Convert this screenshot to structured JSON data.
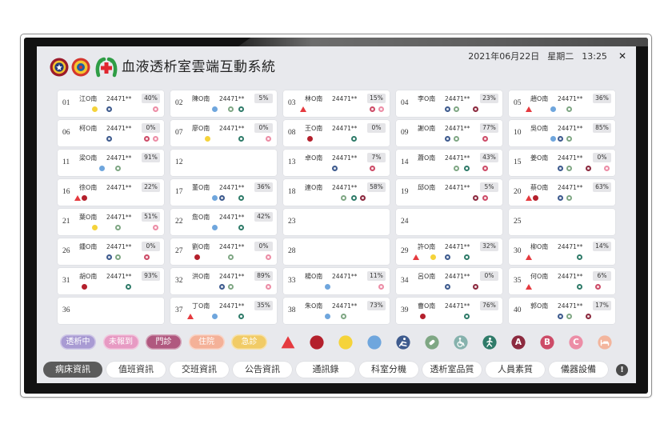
{
  "app": {
    "title": "血液透析室雲端互動系統",
    "date": "2021年06月22日",
    "weekday": "星期二",
    "time": "13:25",
    "close_icon": "close-icon",
    "close_glyph": "✕"
  },
  "logos": [
    "hospital-emblem-logo",
    "association-emblem-logo",
    "green-cross-logo"
  ],
  "colors": {
    "screen_bg": "#e8e9ed",
    "card_bg": "#ffffff",
    "percent_bg": "#e5e5e8",
    "active_tab_bg": "#5b5b5b",
    "tab_bg": "#ffffff"
  },
  "beds": [
    {
      "no": "01",
      "name": "江O南",
      "id": "24471**",
      "progress": "40%",
      "icons": [
        "yellow-dot",
        "wheelchair-navy",
        "grade-c"
      ]
    },
    {
      "no": "02",
      "name": "陳O南",
      "id": "24471**",
      "progress": "5%",
      "icons": [
        "blue-dot",
        "pill-green",
        "person-green"
      ]
    },
    {
      "no": "03",
      "name": "林O南",
      "id": "24471**",
      "progress": "15%",
      "icons": [
        "alert",
        "grade-b",
        "grade-c"
      ]
    },
    {
      "no": "04",
      "name": "李O南",
      "id": "24471**",
      "progress": "23%",
      "icons": [
        "wheelchair-navy",
        "pill-green",
        "grade-a"
      ]
    },
    {
      "no": "05",
      "name": "趙O南",
      "id": "24471**",
      "progress": "36%",
      "icons": [
        "alert",
        "blue-dot",
        "pill-green"
      ]
    },
    {
      "no": "06",
      "name": "柯O南",
      "id": "24471**",
      "progress": "0%",
      "icons": [
        "wheelchair-navy",
        "grade-b",
        "grade-c"
      ]
    },
    {
      "no": "07",
      "name": "廖O南",
      "id": "24471**",
      "progress": "0%",
      "icons": [
        "yellow-dot",
        "person-green",
        "grade-c"
      ]
    },
    {
      "no": "08",
      "name": "王O南",
      "id": "24471**",
      "progress": "0%",
      "icons": [
        "red-dot",
        "person-green"
      ]
    },
    {
      "no": "09",
      "name": "謝O南",
      "id": "24471**",
      "progress": "77%",
      "icons": [
        "wheelchair-navy",
        "pill-green",
        "grade-b"
      ]
    },
    {
      "no": "10",
      "name": "吳O南",
      "id": "24471**",
      "progress": "85%",
      "icons": [
        "blue-dot",
        "wheelchair-navy",
        "pill-green"
      ]
    },
    {
      "no": "11",
      "name": "梁O南",
      "id": "24471**",
      "progress": "91%",
      "icons": [
        "blue-dot",
        "pill-green"
      ]
    },
    {
      "no": "12"
    },
    {
      "no": "13",
      "name": "卓O南",
      "id": "24471**",
      "progress": "7%",
      "icons": [
        "wheelchair-navy",
        "grade-b"
      ]
    },
    {
      "no": "14",
      "name": "蕭O南",
      "id": "24471**",
      "progress": "43%",
      "icons": [
        "pill-green",
        "person-green",
        "grade-b"
      ]
    },
    {
      "no": "15",
      "name": "姜O南",
      "id": "24471**",
      "progress": "0%",
      "icons": [
        "wheelchair-navy",
        "pill-green",
        "grade-a",
        "grade-c"
      ]
    },
    {
      "no": "16",
      "name": "徐O南",
      "id": "24471**",
      "progress": "22%",
      "icons": [
        "alert",
        "red-dot"
      ]
    },
    {
      "no": "17",
      "name": "董O南",
      "id": "24471**",
      "progress": "36%",
      "icons": [
        "blue-dot",
        "wheelchair-navy",
        "person-green"
      ]
    },
    {
      "no": "18",
      "name": "連O南",
      "id": "24471**",
      "progress": "58%",
      "icons": [
        "pill-green",
        "person-green",
        "grade-a"
      ]
    },
    {
      "no": "19",
      "name": "邱O南",
      "id": "24471**",
      "progress": "5%",
      "icons": [
        "grade-a",
        "grade-b"
      ]
    },
    {
      "no": "20",
      "name": "蔡O南",
      "id": "24471**",
      "progress": "63%",
      "icons": [
        "alert",
        "red-dot",
        "wheelchair-navy",
        "pill-green"
      ]
    },
    {
      "no": "21",
      "name": "葉O南",
      "id": "24471**",
      "progress": "51%",
      "icons": [
        "yellow-dot",
        "pill-green",
        "grade-c"
      ]
    },
    {
      "no": "22",
      "name": "詹O南",
      "id": "24471**",
      "progress": "42%",
      "icons": [
        "blue-dot",
        "person-green"
      ]
    },
    {
      "no": "23"
    },
    {
      "no": "24"
    },
    {
      "no": "25"
    },
    {
      "no": "26",
      "name": "鍾O南",
      "id": "24471**",
      "progress": "0%",
      "icons": [
        "wheelchair-navy",
        "pill-green",
        "grade-b"
      ]
    },
    {
      "no": "27",
      "name": "劉O南",
      "id": "24471**",
      "progress": "0%",
      "icons": [
        "red-dot",
        "pill-green",
        "grade-c"
      ]
    },
    {
      "no": "28"
    },
    {
      "no": "29",
      "name": "許O南",
      "id": "24471**",
      "progress": "32%",
      "icons": [
        "alert",
        "yellow-dot",
        "wheelchair-navy",
        "person-green"
      ]
    },
    {
      "no": "30",
      "name": "柳O南",
      "id": "24471**",
      "progress": "14%",
      "icons": [
        "alert",
        "person-green"
      ]
    },
    {
      "no": "31",
      "name": "胡O南",
      "id": "24471**",
      "progress": "93%",
      "icons": [
        "red-dot",
        "person-green"
      ]
    },
    {
      "no": "32",
      "name": "洪O南",
      "id": "24471**",
      "progress": "89%",
      "icons": [
        "wheelchair-navy",
        "pill-green",
        "grade-c"
      ]
    },
    {
      "no": "33",
      "name": "楊O南",
      "id": "24471**",
      "progress": "11%",
      "icons": [
        "blue-dot",
        "grade-c"
      ]
    },
    {
      "no": "34",
      "name": "呂O南",
      "id": "24471**",
      "progress": "0%",
      "icons": [
        "wheelchair-navy",
        "grade-a"
      ]
    },
    {
      "no": "35",
      "name": "何O南",
      "id": "24471**",
      "progress": "6%",
      "icons": [
        "alert",
        "person-green",
        "grade-b"
      ]
    },
    {
      "no": "36"
    },
    {
      "no": "37",
      "name": "丁O南",
      "id": "24471**",
      "progress": "35%",
      "icons": [
        "alert",
        "blue-dot",
        "person-green"
      ]
    },
    {
      "no": "38",
      "name": "朱O南",
      "id": "24471**",
      "progress": "73%",
      "icons": [
        "blue-dot",
        "pill-green"
      ]
    },
    {
      "no": "39",
      "name": "曹O南",
      "id": "24471**",
      "progress": "76%",
      "icons": [
        "red-dot",
        "person-green"
      ]
    },
    {
      "no": "40",
      "name": "郭O南",
      "id": "24471**",
      "progress": "17%",
      "icons": [
        "wheelchair-navy",
        "pill-green",
        "grade-a"
      ]
    }
  ],
  "legend": {
    "statuses": [
      {
        "label": "透析中",
        "color": "#a99bd3"
      },
      {
        "label": "未報到",
        "color": "#e79ac3"
      },
      {
        "label": "門診",
        "color": "#b0587f"
      },
      {
        "label": "住院",
        "color": "#f4b198"
      },
      {
        "label": "急診",
        "color": "#f1cb66"
      }
    ],
    "icons": [
      {
        "type": "alert",
        "name": "alert-icon",
        "color": "#e53a3f"
      },
      {
        "type": "red-dot",
        "name": "red-dot-icon",
        "color": "#b4202c"
      },
      {
        "type": "yellow-dot",
        "name": "yellow-dot-icon",
        "color": "#f5d33a"
      },
      {
        "type": "blue-dot",
        "name": "blue-dot-icon",
        "color": "#6fa6dd"
      },
      {
        "type": "wheelchair-navy",
        "name": "wheelchair-navy-icon",
        "color": "#3e5b8e"
      },
      {
        "type": "pill-green",
        "name": "pill-icon",
        "color": "#7fa784"
      },
      {
        "type": "wheelchair",
        "name": "wheelchair-icon",
        "color": "#86b2ad"
      },
      {
        "type": "person-green",
        "name": "person-icon",
        "color": "#2f7b69"
      },
      {
        "type": "grade-a",
        "name": "grade-a-icon",
        "color": "#8c2a3f",
        "letter": "A"
      },
      {
        "type": "grade-b",
        "name": "grade-b-icon",
        "color": "#cd4c68",
        "letter": "B"
      },
      {
        "type": "grade-c",
        "name": "grade-c-icon",
        "color": "#ec8da6",
        "letter": "C"
      },
      {
        "type": "bed",
        "name": "bed-icon",
        "color": "#f3b59d"
      }
    ]
  },
  "nav": {
    "items": [
      {
        "label": "病床資訊",
        "active": true
      },
      {
        "label": "值班資訊",
        "active": false
      },
      {
        "label": "交班資訊",
        "active": false
      },
      {
        "label": "公告資訊",
        "active": false
      },
      {
        "label": "通訊錄",
        "active": false
      },
      {
        "label": "科室分機",
        "active": false
      },
      {
        "label": "透析室品質",
        "active": false
      },
      {
        "label": "人員素質",
        "active": false
      },
      {
        "label": "儀器設備",
        "active": false
      }
    ],
    "info_icon": "info-icon",
    "info_glyph": "!"
  }
}
